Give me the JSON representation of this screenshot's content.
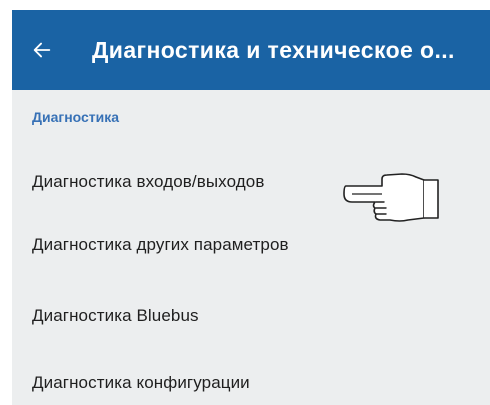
{
  "appbar": {
    "back_icon": "arrow-left-icon",
    "title": "Диагностика и техническое о...",
    "color": "#1a63a4"
  },
  "section": {
    "header": "Диагностика",
    "color": "#3771b6"
  },
  "items": [
    {
      "label": "Диагностика входов/выходов"
    },
    {
      "label": "Диагностика других параметров"
    },
    {
      "label": "Диагностика Bluebus"
    },
    {
      "label": "Диагностика конфигурации"
    }
  ],
  "pointer": {
    "icon": "pointing-hand-icon",
    "target": "Диагностика входов/выходов"
  },
  "background": "#eceeef"
}
